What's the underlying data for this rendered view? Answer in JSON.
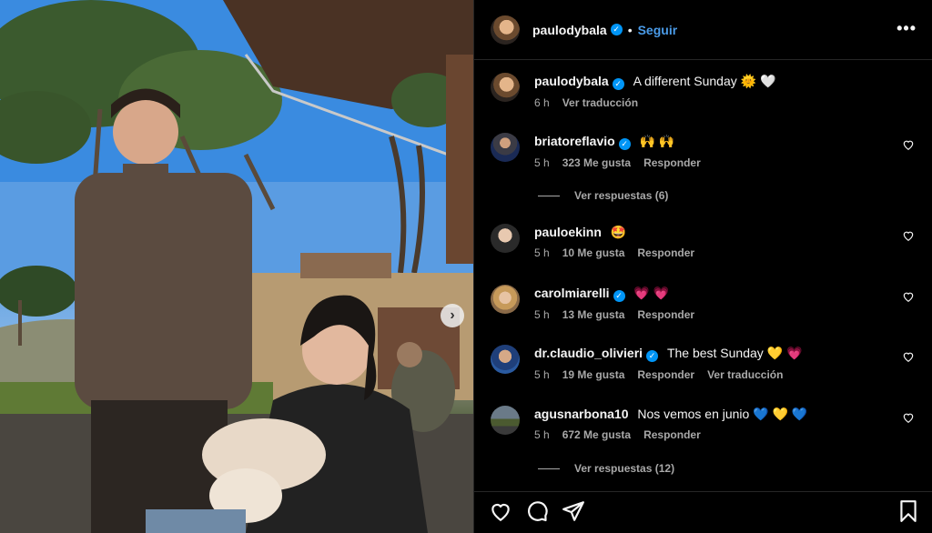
{
  "post": {
    "author": "paulodybala",
    "follow_label": "Seguir",
    "separator": "•",
    "more_label": "•••",
    "caption": "A different Sunday 🌞 🤍",
    "caption_time": "6 h",
    "caption_translate": "Ver traducción"
  },
  "comments": [
    {
      "user": "briatoreflavio",
      "verified": true,
      "text": "🙌 🙌",
      "time": "5 h",
      "likes": "323 Me gusta",
      "reply": "Responder",
      "translate": "",
      "replies": "Ver respuestas (6)"
    },
    {
      "user": "pauloekinn",
      "verified": false,
      "text": "🤩",
      "time": "5 h",
      "likes": "10 Me gusta",
      "reply": "Responder",
      "translate": "",
      "replies": ""
    },
    {
      "user": "carolmiarelli",
      "verified": true,
      "text": "💗 💗",
      "time": "5 h",
      "likes": "13 Me gusta",
      "reply": "Responder",
      "translate": "",
      "replies": ""
    },
    {
      "user": "dr.claudio_olivieri",
      "verified": true,
      "text": "The best Sunday 💛 💗",
      "time": "5 h",
      "likes": "19 Me gusta",
      "reply": "Responder",
      "translate": "Ver traducción",
      "replies": ""
    },
    {
      "user": "agusnarbona10",
      "verified": false,
      "text": "Nos vemos en junio 💙 💛 💙",
      "time": "5 h",
      "likes": "672 Me gusta",
      "reply": "Responder",
      "translate": "",
      "replies": "Ver respuestas (12)"
    }
  ],
  "icons": {
    "like": "heart-icon",
    "comment": "comment-icon",
    "share": "send-icon",
    "save": "bookmark-icon",
    "next": "chevron-right-icon",
    "verified": "verified-badge-icon"
  },
  "colors": {
    "background": "#000000",
    "accent": "#4a9be8",
    "verified": "#0095f6",
    "secondary_text": "#a8a8a8"
  }
}
